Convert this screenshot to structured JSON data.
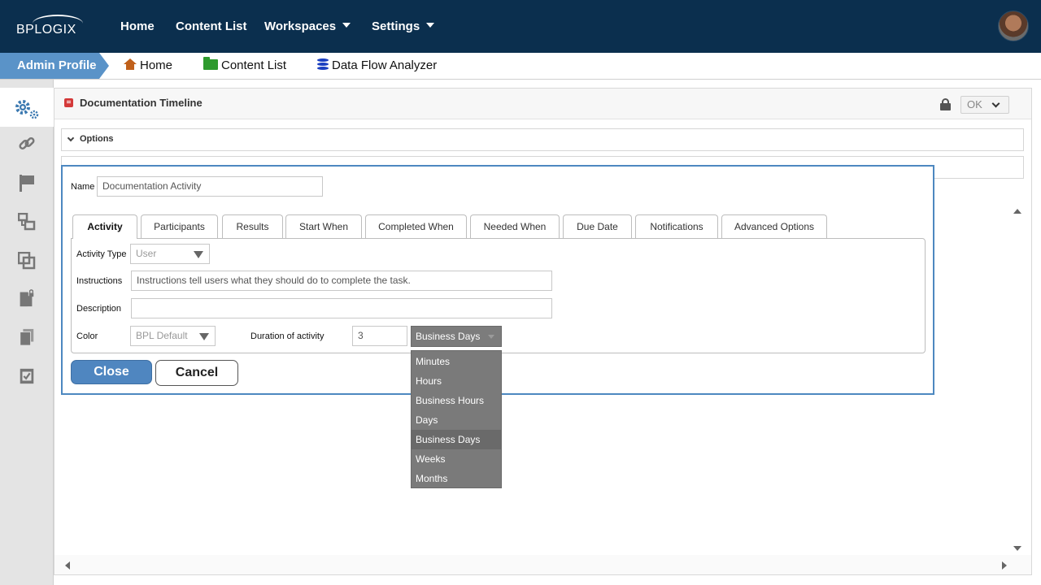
{
  "header": {
    "logo_text": "BPLOGIX",
    "nav": [
      {
        "label": "Home"
      },
      {
        "label": "Content List"
      },
      {
        "label": "Workspaces"
      },
      {
        "label": "Settings"
      }
    ]
  },
  "breadcrumb": {
    "active": "Admin Profile",
    "items": [
      {
        "label": "Home",
        "icon": "home-icon"
      },
      {
        "label": "Content List",
        "icon": "folder-icon"
      },
      {
        "label": "Data Flow Analyzer",
        "icon": "database-icon"
      }
    ]
  },
  "sidebar": {
    "icons": [
      "gears-icon",
      "link-icon",
      "flag-icon",
      "workflow-icon",
      "copy-icon",
      "locked-document-icon",
      "documents-icon",
      "checked-document-icon"
    ]
  },
  "panel": {
    "title": "Documentation Timeline",
    "ok_label": "OK",
    "options_label": "Options"
  },
  "dialog": {
    "name_label": "Name",
    "name_value": "Documentation Activity",
    "tabs": [
      {
        "label": "Activity",
        "active": true
      },
      {
        "label": "Participants"
      },
      {
        "label": "Results"
      },
      {
        "label": "Start When"
      },
      {
        "label": "Completed When"
      },
      {
        "label": "Needed When"
      },
      {
        "label": "Due Date"
      },
      {
        "label": "Notifications"
      },
      {
        "label": "Advanced Options"
      }
    ],
    "activity_type_label": "Activity Type",
    "activity_type_value": "User",
    "instructions_label": "Instructions",
    "instructions_value": "Instructions tell users what they should do to complete the task.",
    "description_label": "Description",
    "description_value": "",
    "color_label": "Color",
    "color_value": "BPL Default",
    "duration_label": "Duration of activity",
    "duration_value": "3",
    "duration_unit": "Business Days",
    "duration_options": [
      "Minutes",
      "Hours",
      "Business Hours",
      "Days",
      "Business Days",
      "Weeks",
      "Months"
    ],
    "close_label": "Close",
    "cancel_label": "Cancel"
  },
  "colors": {
    "topbar": "#0b2f4e",
    "accent": "#5a93c8",
    "dialog_border": "#4d88c0",
    "dropdown_bg": "#7a7a7a"
  }
}
